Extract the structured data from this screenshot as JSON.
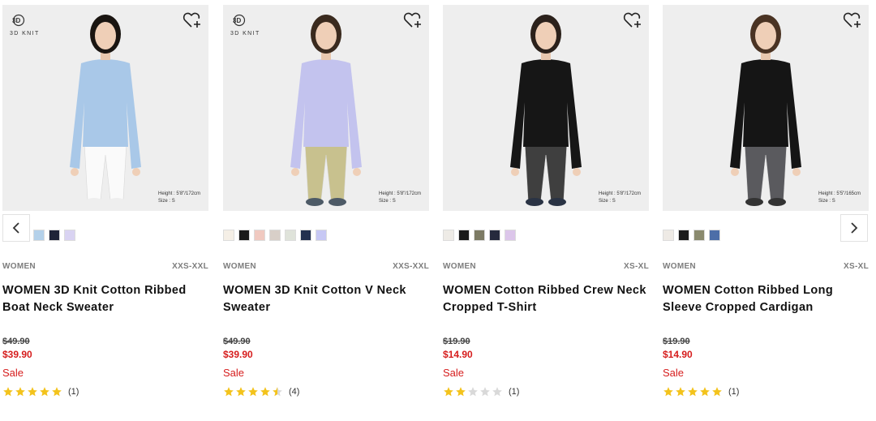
{
  "products": [
    {
      "badge": "3D KNIT",
      "model_height": "Height : 5'8\"/172cm",
      "model_size": "Size : S",
      "swatch_colors": [
        "#f3f0ea",
        "#f1e6cf",
        "#b4d1ea",
        "#1f2438",
        "#d9d3f2"
      ],
      "gender": "WOMEN",
      "size_range": "XXS-XXL",
      "name": "WOMEN 3D Knit Cotton Ribbed Boat Neck Sweater",
      "original_price": "$49.90",
      "sale_price": "$39.90",
      "sale_label": "Sale",
      "rating": 5,
      "review_count": "(1)",
      "top_color": "#a9c8e8",
      "bottom_color": "#fafafa",
      "hair_color": "#1a1511",
      "shoe_color": "#eeeeee"
    },
    {
      "badge": "3D KNIT",
      "model_height": "Height : 5'8\"/172cm",
      "model_size": "Size : S",
      "swatch_colors": [
        "#f5efe6",
        "#1b1b1b",
        "#f0c9c0",
        "#d8cfc8",
        "#dfe3da",
        "#23304f",
        "#c7c8f4"
      ],
      "gender": "WOMEN",
      "size_range": "XXS-XXL",
      "name": "WOMEN 3D Knit Cotton V Neck Sweater",
      "original_price": "$49.90",
      "sale_price": "$39.90",
      "sale_label": "Sale",
      "rating": 4.5,
      "review_count": "(4)",
      "top_color": "#c3c3ee",
      "bottom_color": "#c8c18e",
      "hair_color": "#3a2a1e",
      "shoe_color": "#4d5a66"
    },
    {
      "badge": "",
      "model_height": "Height : 5'8\"/172cm",
      "model_size": "Size : S",
      "swatch_colors": [
        "#eeebe6",
        "#1b1b1b",
        "#7d7b64",
        "#262a3d",
        "#dcc6ea"
      ],
      "gender": "WOMEN",
      "size_range": "XS-XL",
      "name": "WOMEN Cotton Ribbed Crew Neck Cropped T-Shirt",
      "original_price": "$19.90",
      "sale_price": "$14.90",
      "sale_label": "Sale",
      "rating": 2,
      "review_count": "(1)",
      "top_color": "#161616",
      "bottom_color": "#3f3f3f",
      "hair_color": "#2b211b",
      "shoe_color": "#2a3344"
    },
    {
      "badge": "",
      "model_height": "Height : 5'5\"/165cm",
      "model_size": "Size : S",
      "swatch_colors": [
        "#eeeae5",
        "#1b1b1b",
        "#8a8a6e",
        "#4d6ea8"
      ],
      "gender": "WOMEN",
      "size_range": "XS-XL",
      "name": "WOMEN Cotton Ribbed Long Sleeve Cropped Cardigan",
      "original_price": "$19.90",
      "sale_price": "$14.90",
      "sale_label": "Sale",
      "rating": 5,
      "review_count": "(1)",
      "top_color": "#151515",
      "bottom_color": "#5a5a5e",
      "hair_color": "#4a3323",
      "shoe_color": "#333333"
    }
  ],
  "carousel": {
    "prev_icon": "chevron-left-icon",
    "next_icon": "chevron-right-icon"
  },
  "colors": {
    "sale_red": "#d61d1d",
    "star_gold": "#f3c31c",
    "star_empty": "#d9d9d9",
    "image_bg": "#eeeeee"
  }
}
